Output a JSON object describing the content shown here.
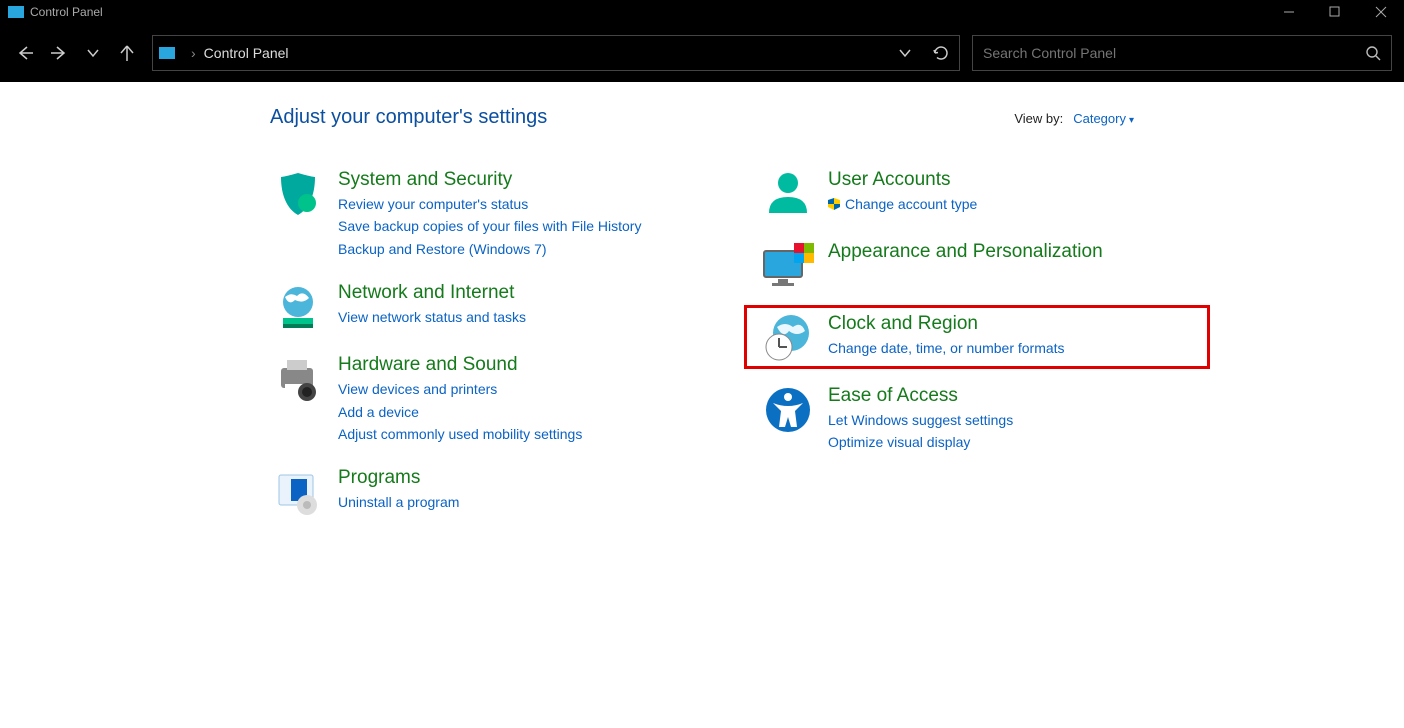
{
  "titlebar": {
    "title": "Control Panel"
  },
  "address": {
    "crumb": "Control Panel"
  },
  "search": {
    "placeholder": "Search Control Panel"
  },
  "header": {
    "title": "Adjust your computer's settings",
    "viewby_label": "View by:",
    "viewby_value": "Category"
  },
  "left": {
    "system": {
      "title": "System and Security",
      "link1": "Review your computer's status",
      "link2": "Save backup copies of your files with File History",
      "link3": "Backup and Restore (Windows 7)"
    },
    "network": {
      "title": "Network and Internet",
      "link1": "View network status and tasks"
    },
    "hardware": {
      "title": "Hardware and Sound",
      "link1": "View devices and printers",
      "link2": "Add a device",
      "link3": "Adjust commonly used mobility settings"
    },
    "programs": {
      "title": "Programs",
      "link1": "Uninstall a program"
    }
  },
  "right": {
    "user": {
      "title": "User Accounts",
      "link1": "Change account type"
    },
    "appearance": {
      "title": "Appearance and Personalization"
    },
    "clock": {
      "title": "Clock and Region",
      "link1": "Change date, time, or number formats"
    },
    "ease": {
      "title": "Ease of Access",
      "link1": "Let Windows suggest settings",
      "link2": "Optimize visual display"
    }
  }
}
